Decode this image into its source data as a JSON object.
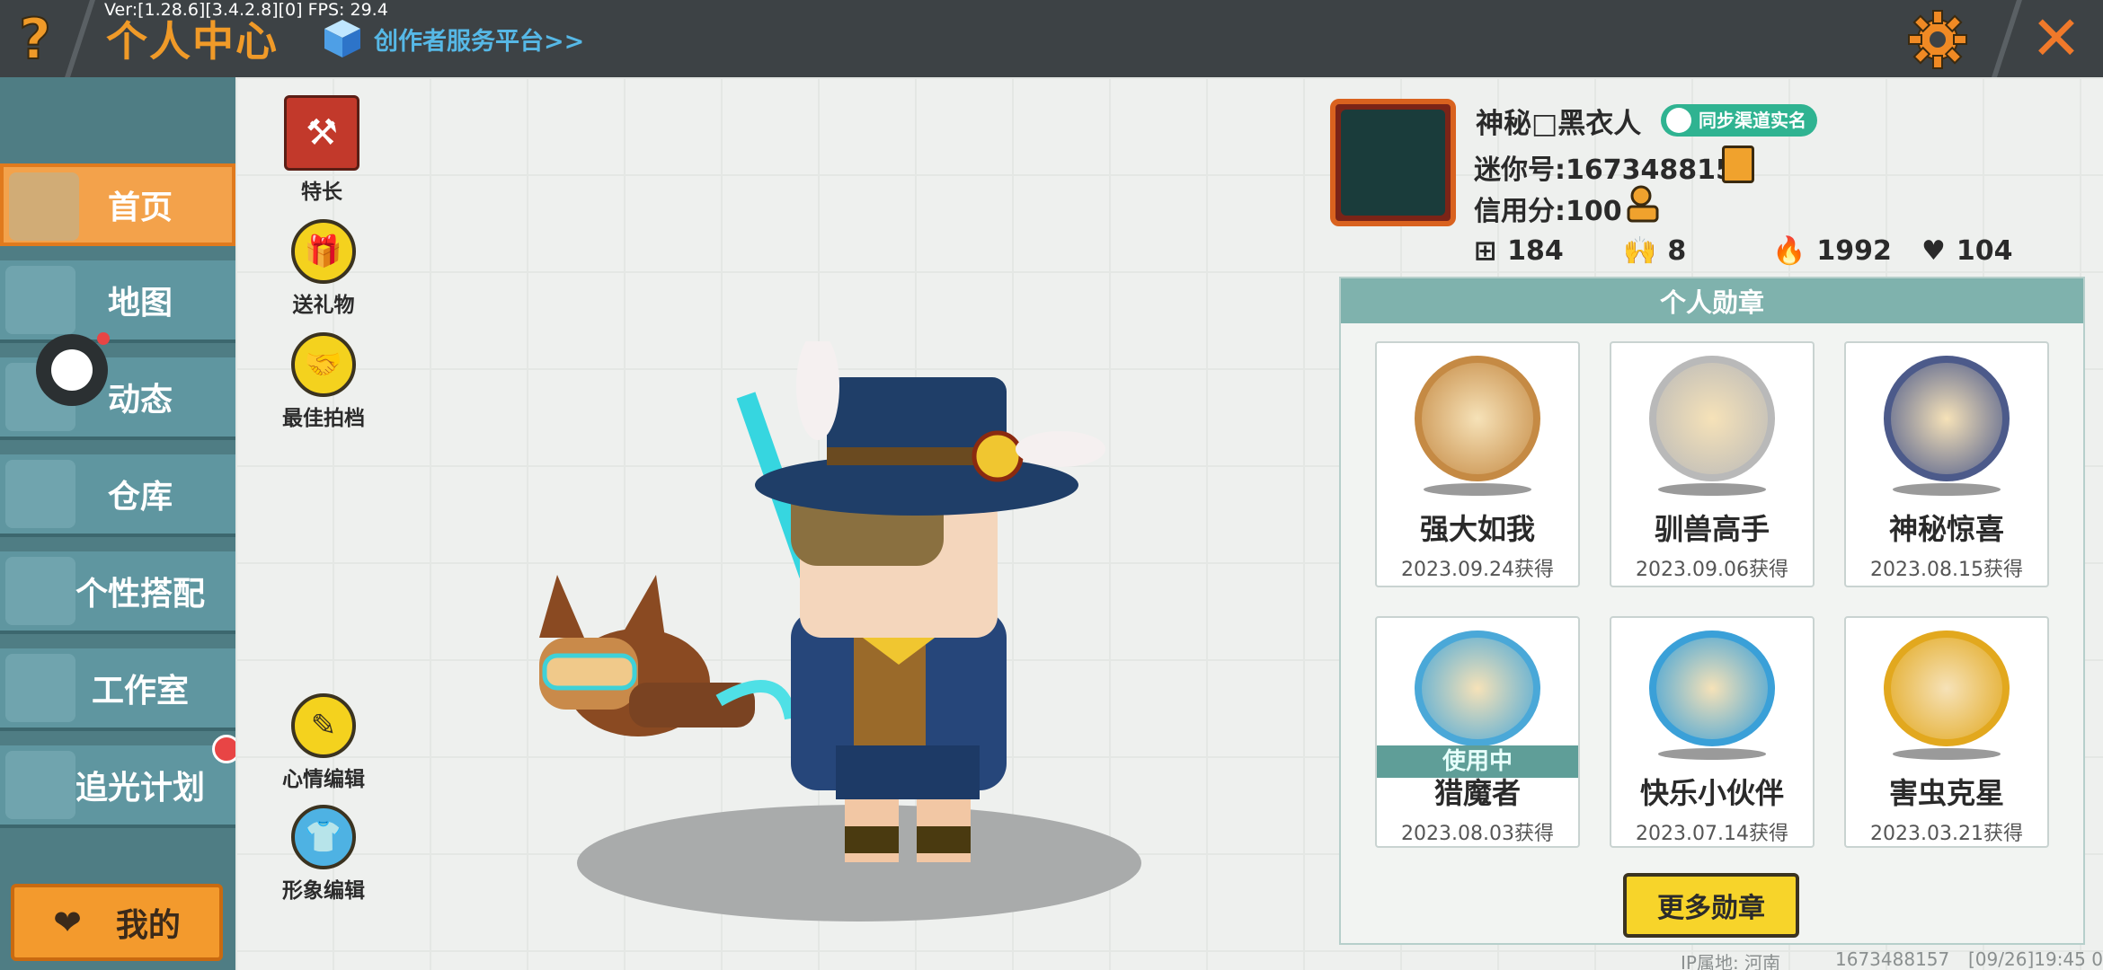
{
  "topbar": {
    "version": "Ver:[1.28.6][3.4.2.8][0] FPS: 29.4",
    "help_glyph": "?",
    "title": "个人中心",
    "creator_link": "创作者服务平台>>",
    "close_glyph": "✕"
  },
  "nav": {
    "items": [
      {
        "label": "首页",
        "active": true
      },
      {
        "label": "地图",
        "active": false
      },
      {
        "label": "动态",
        "active": false
      },
      {
        "label": "仓库",
        "active": false
      },
      {
        "label": "个性搭配",
        "active": false
      },
      {
        "label": "工作室",
        "active": false
      },
      {
        "label": "追光计划",
        "active": false
      }
    ],
    "my_button": "我的"
  },
  "actions": {
    "specialty": "特长",
    "gift": "送礼物",
    "partner": "最佳拍档",
    "mood_edit": "心情编辑",
    "look_edit": "形象编辑"
  },
  "profile": {
    "nickname": "神秘□黑衣人",
    "sync_badge": "同步渠道实名",
    "mini_id": "迷你号:1673488157",
    "credit": "信用分:100",
    "stats": {
      "plus": "184",
      "fans": "8",
      "heat": "1992",
      "likes": "104"
    }
  },
  "medals": {
    "header": "个人勋章",
    "items": [
      {
        "name": "强大如我",
        "date": "2023.09.24获得",
        "color": "#c58a44",
        "in_use": false
      },
      {
        "name": "驯兽高手",
        "date": "2023.09.06获得",
        "color": "#b9b9b9",
        "in_use": false
      },
      {
        "name": "神秘惊喜",
        "date": "2023.08.15获得",
        "color": "#4c5a8a",
        "in_use": false
      },
      {
        "name": "猎魔者",
        "date": "2023.08.03获得",
        "color": "#4aa8d8",
        "in_use": true
      },
      {
        "name": "快乐小伙伴",
        "date": "2023.07.14获得",
        "color": "#3aa0d8",
        "in_use": false
      },
      {
        "name": "害虫克星",
        "date": "2023.03.21获得",
        "color": "#e2a81e",
        "in_use": false
      }
    ],
    "in_use_label": "使用中",
    "more_button": "更多勋章"
  },
  "footer": {
    "ip_label": "IP属地: 河南",
    "uid": "1673488157",
    "timestamp": "[09/26]19:45 0"
  },
  "colors": {
    "accent_orange": "#f09a28",
    "nav_teal": "#5f96a0",
    "panel_header": "#7fb2ad",
    "button_yellow": "#f7d42a"
  }
}
